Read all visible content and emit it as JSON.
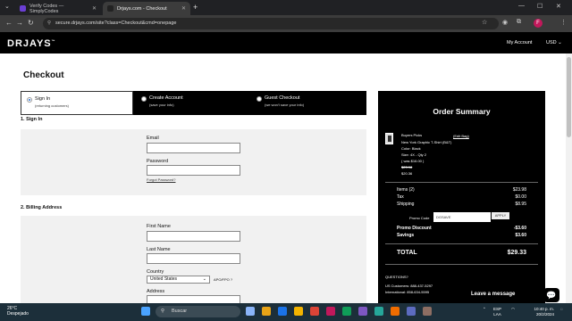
{
  "browser": {
    "tabs": [
      {
        "title": "Verify Codes — SimplyCodes",
        "active": false,
        "favicon_color": "#6b3fd4"
      },
      {
        "title": "Drjays.com - Checkout",
        "active": true,
        "favicon_color": "#222222"
      }
    ],
    "url": "secure.drjays.com/site?class=Checkout&cmd=onepage",
    "profile_letter": "F"
  },
  "site": {
    "logo": "DRJAYS",
    "logo_mark": "™",
    "nav": {
      "account": "My Account",
      "currency": "USD"
    }
  },
  "checkout": {
    "title": "Checkout",
    "methods": [
      {
        "label": "Sign In",
        "sub": "(returning customers)",
        "selected": true
      },
      {
        "label": "Create Account",
        "sub": "(save your info)",
        "selected": false
      },
      {
        "label": "Guest Checkout",
        "sub": "(we won't save your info)",
        "selected": false
      }
    ],
    "signin": {
      "section_title": "1. Sign In",
      "email_label": "Email",
      "password_label": "Password",
      "forgot": "Forgot Password?"
    },
    "billing": {
      "section_title": "2. Billing Address",
      "first_name_label": "First Name",
      "last_name_label": "Last Name",
      "country_label": "Country",
      "country_value": "United States",
      "apo": "APO/FPO ?",
      "address_label": "Address"
    }
  },
  "summary": {
    "title": "Order Summary",
    "product": {
      "brand": "Buyers Picks",
      "name": "New York Graphic T-Shirt (B&T)",
      "color": "Color: Black",
      "size_qty": "Size: 4X - Qty 2",
      "was": "( was $16.00 )",
      "old_price": "$23.98",
      "new_price": "$20.36",
      "edit": "(Edit Bag)"
    },
    "rows": [
      {
        "label": "Items (2)",
        "value": "$23.98"
      },
      {
        "label": "Tax",
        "value": "$0.00"
      },
      {
        "label": "Shipping",
        "value": "$8.95"
      }
    ],
    "promo": {
      "label": "Promo Code",
      "value": "DGSAVE",
      "button": "APPLY"
    },
    "discounts": [
      {
        "label": "Promo Discount",
        "value": "-$3.60"
      },
      {
        "label": "Savings",
        "value": "$3.60"
      }
    ],
    "total": {
      "label": "TOTAL",
      "value": "$29.33"
    },
    "questions": {
      "title": "QUESTIONS?",
      "us": "US Customers: 888-437-5297",
      "intl": "International: 858-634-5595"
    },
    "leave_message": "Leave a message"
  },
  "taskbar": {
    "temp": "26°C",
    "condition": "Despejado",
    "search": "Buscar",
    "lang1": "ESP",
    "lang2": "LAA",
    "time": "10:40 p. m.",
    "date": "20/2/2024"
  }
}
